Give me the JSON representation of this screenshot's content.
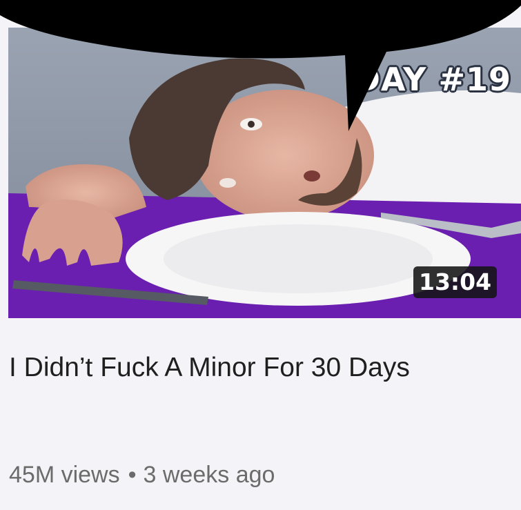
{
  "video": {
    "thumbnail_overlay_text": "DAY #19",
    "duration": "13:04",
    "title": "I Didn’t Fuck A Minor For 30 Days",
    "views": "45M views",
    "separator": "•",
    "age": "3 weeks ago"
  },
  "colors": {
    "background": "#f4f3f7",
    "tablecloth": "#6a1fb0",
    "bubble": "#000000",
    "title_text": "#1f1f1f",
    "meta_text": "#6b6b6b"
  }
}
